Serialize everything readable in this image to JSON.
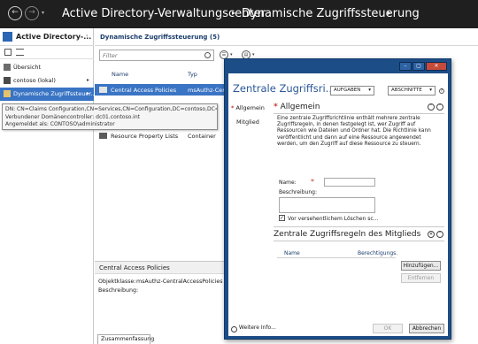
{
  "app": {
    "nav_back": "←",
    "nav_forward": "→",
    "nav_dropdown": "▾",
    "breadcrumb": [
      "Active Directory-Verwaltungscenter",
      "Dynamische Zugriffssteuerung"
    ],
    "breadcrumb_sep": "▸"
  },
  "sidebar": {
    "title": "Active Directory-...",
    "collapse": "‹",
    "items": [
      {
        "label": "Übersicht",
        "icon": "overview-icon"
      },
      {
        "label": "contoso (lokal)",
        "icon": "domain-icon",
        "arrow": "▸"
      },
      {
        "label": "Dynamische Zugriffssteuer...",
        "icon": "folder-icon",
        "arrow": "▸",
        "selected": true
      }
    ]
  },
  "tooltip": {
    "lines": [
      "DN: CN=Claims Configuration,CN=Services,CN=Configuration,DC=contoso,DC=int",
      "Verbundener Domänencontroller: dc01.contoso.int",
      "Angemeldet als: CONTOSO\\administrator"
    ]
  },
  "main": {
    "title": "Dynamische Zugriffssteuerung  (5)",
    "filter_placeholder": "Filter",
    "view_buttons": [
      "☰",
      "▤"
    ],
    "columns": [
      "Name",
      "Typ"
    ],
    "rows": [
      {
        "name": "Central Access Policies",
        "type": "msAuthz-Cent",
        "selected": true
      },
      {
        "name": "Resource Property Lists",
        "type": "Container"
      }
    ]
  },
  "details": {
    "header": "Central Access Policies",
    "objektklasse_label": "Objektklasse:",
    "objektklasse_value": "msAuthz-CentralAccessPolicies",
    "beschreibung_label": "Beschreibung:",
    "tab": "Zusammenfassung"
  },
  "dialog": {
    "window_buttons": [
      "–",
      "▢",
      "✕"
    ],
    "title": "Zentrale Zugriffsri...",
    "dropdown_tasks": "AUFGABEN",
    "dropdown_sections": "ABSCHNITTE",
    "dropdown_arrow": "▾",
    "help": "?",
    "nav": [
      {
        "label": "Allgemein",
        "required": "*"
      },
      {
        "label": "Mitglied"
      }
    ],
    "general": {
      "title": "Allgemein",
      "star": "*",
      "description": "Eine zentrale Zugriffsrichtlinie enthält mehrere zentrale Zugriffsregeln, in denen festgelegt ist, wer Zugriff auf Ressourcen wie Dateien und Ordner hat. Die Richtlinie kann veröffentlicht und dann auf eine Ressource angewendet werden, um den Zugriff auf diese Ressource zu steuern.",
      "name_label": "Name:",
      "name_star": "*",
      "name_value": "",
      "beschreibung_label": "Beschreibung:",
      "protect_label": "Vor versehentlichem Löschen sc...",
      "protect_checked": "✓"
    },
    "members": {
      "title": "Zentrale Zugriffsregeln des Mitglieds",
      "col_name": "Name",
      "col_rights": "Berechtigungs.",
      "add_button": "Hinzufügen...",
      "remove_button": "Entfernen"
    },
    "footer": {
      "more_info": "Weitere Info...",
      "ok": "OK",
      "cancel": "Abbrechen"
    }
  }
}
